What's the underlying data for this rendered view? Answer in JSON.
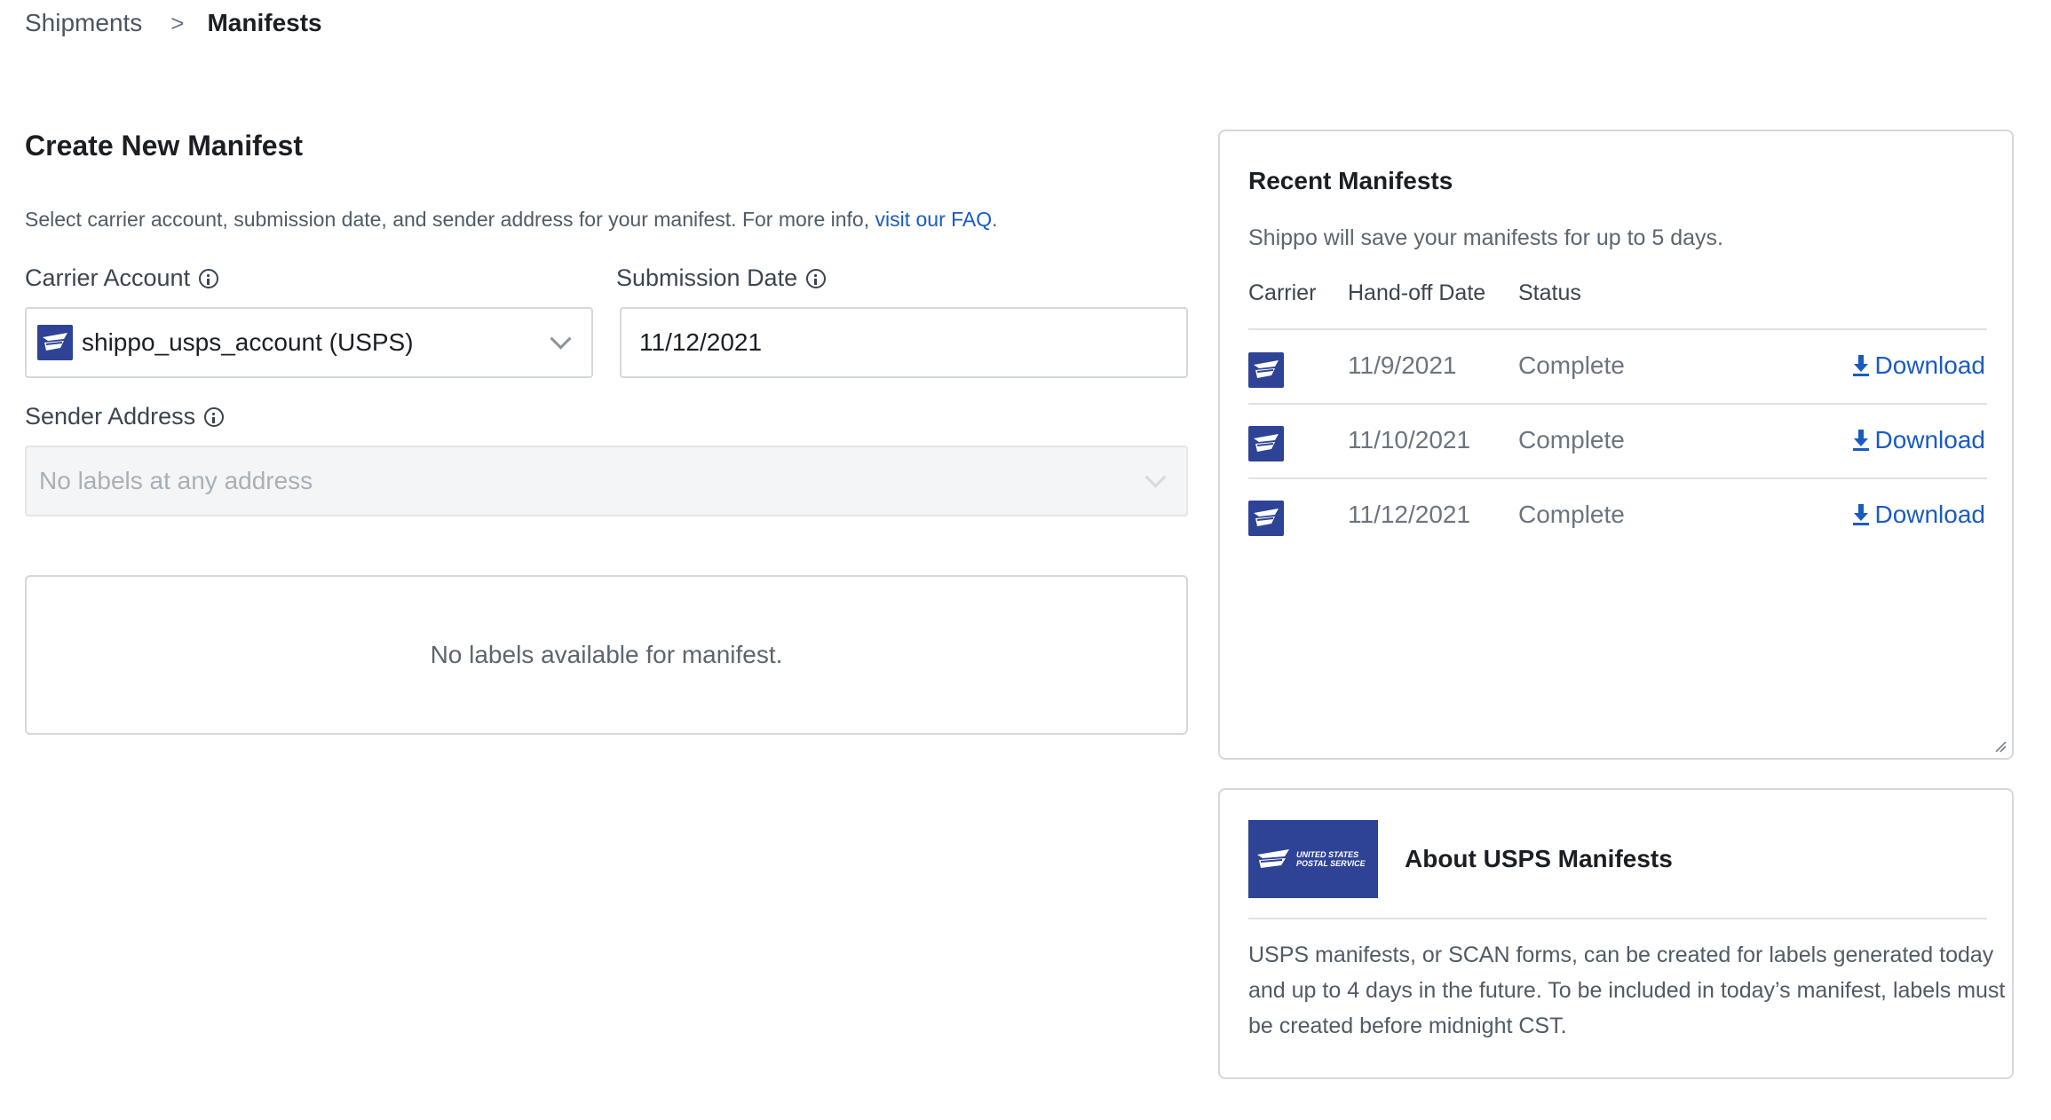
{
  "breadcrumb": {
    "parent": "Shipments",
    "separator": ">",
    "current": "Manifests"
  },
  "create": {
    "title": "Create New Manifest",
    "description": "Select carrier account, submission date, and sender address for your manifest. For more info, ",
    "faq_link": "visit our FAQ",
    "description_end": ".",
    "carrier_label": "Carrier Account",
    "carrier_value": "shippo_usps_account (USPS)",
    "date_label": "Submission Date",
    "date_value": "11/12/2021",
    "sender_label": "Sender Address",
    "sender_placeholder": "No labels at any address",
    "empty_message": "No labels available for manifest."
  },
  "recent": {
    "title": "Recent Manifests",
    "subtitle": "Shippo will save your manifests for up to 5 days.",
    "columns": [
      "Carrier",
      "Hand-off Date",
      "Status"
    ],
    "rows": [
      {
        "date": "11/9/2021",
        "status": "Complete",
        "action": "Download"
      },
      {
        "date": "11/10/2021",
        "status": "Complete",
        "action": "Download"
      },
      {
        "date": "11/12/2021",
        "status": "Complete",
        "action": "Download"
      }
    ]
  },
  "about": {
    "logo_line1": "UNITED STATES",
    "logo_line2": "POSTAL SERVICE",
    "title": "About USPS Manifests",
    "body": "USPS manifests, or SCAN forms, can be created for labels generated today and up to 4 days in the future. To be included in today’s manifest, labels must be created before midnight CST."
  },
  "colors": {
    "link": "#1a5bc2",
    "usps_blue": "#2f4396",
    "border": "#d4d8dc"
  },
  "icons": [
    "usps-eagle-icon",
    "info-icon",
    "chevron-down-icon",
    "download-icon",
    "resize-handle-icon"
  ]
}
